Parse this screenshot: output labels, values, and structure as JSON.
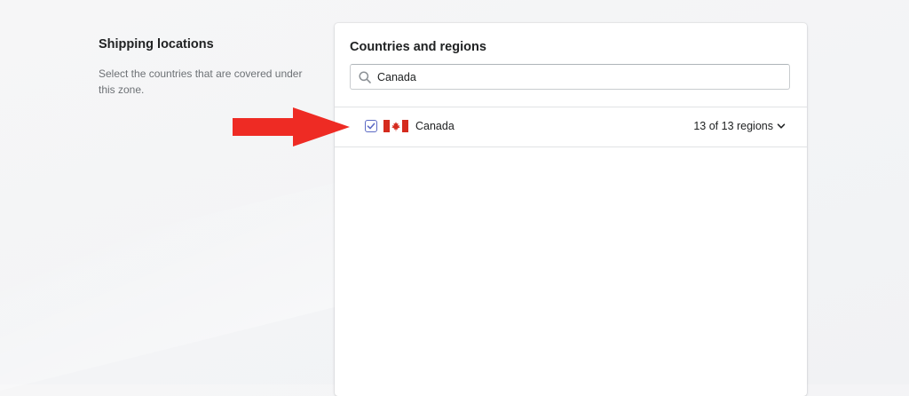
{
  "aside": {
    "title": "Shipping locations",
    "description": "Select the countries that are covered under this zone."
  },
  "card": {
    "title": "Countries and regions",
    "search": {
      "value": "Canada",
      "icon": "search-icon"
    },
    "countries": [
      {
        "name": "Canada",
        "checked": true,
        "flag": "canada-flag-icon",
        "regions_label": "13 of 13 regions"
      }
    ]
  },
  "annotation": {
    "icon": "arrow-right-icon",
    "color": "#ee2b24"
  },
  "colors": {
    "accent": "#5c6ac4",
    "flag_red": "#d52b1e"
  }
}
